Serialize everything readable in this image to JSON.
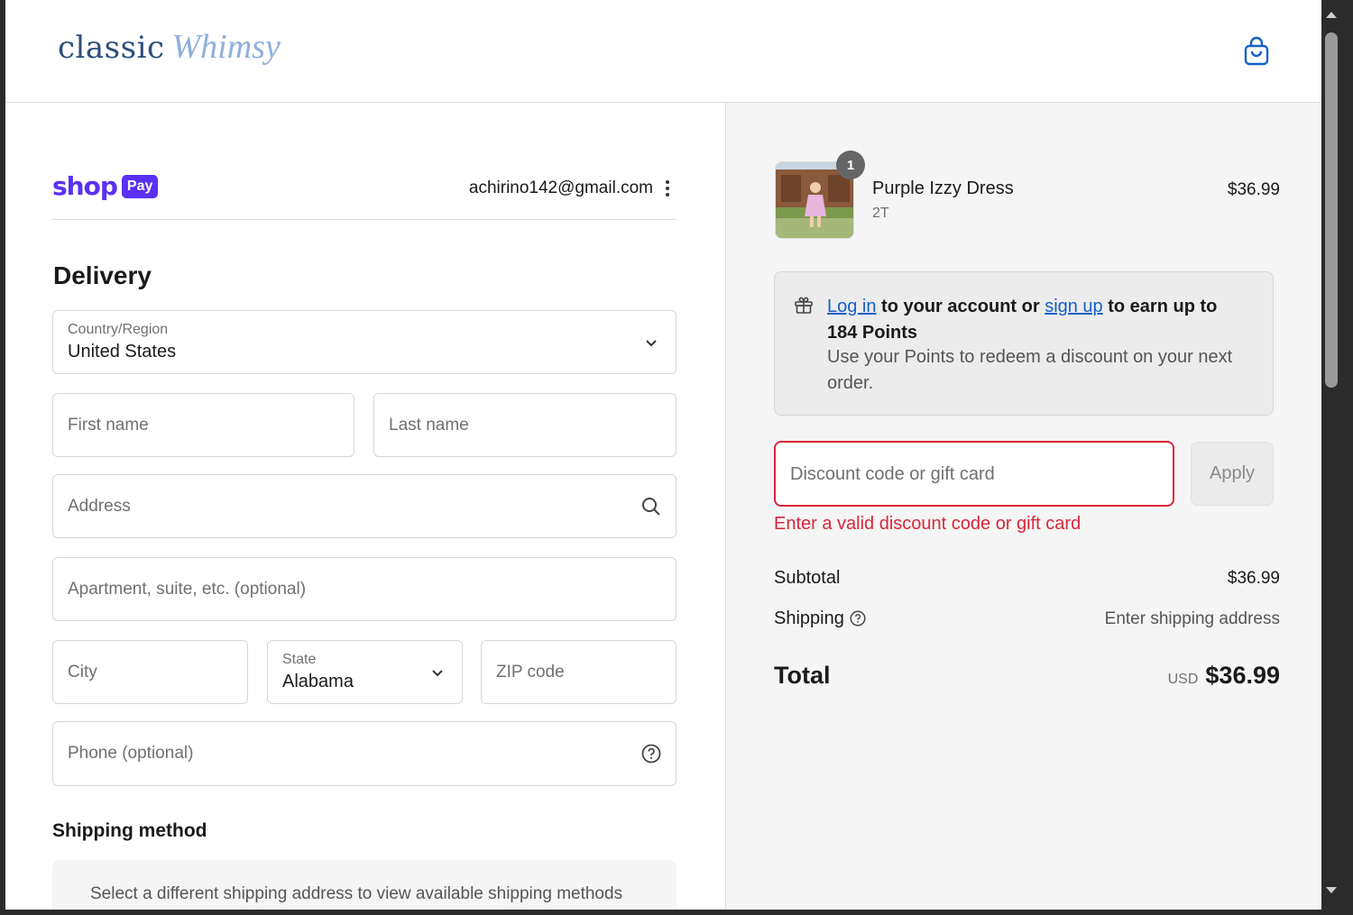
{
  "header": {
    "logo_classic": "classic",
    "logo_whimsy": "Whimsy",
    "cart_icon": "shopping-bag-icon"
  },
  "shop_pay": {
    "shop_text": "shop",
    "pay_badge": "Pay",
    "email": "achirino142@gmail.com",
    "menu_icon": "kebab-menu-icon"
  },
  "delivery": {
    "heading": "Delivery",
    "country": {
      "label": "Country/Region",
      "value": "United States"
    },
    "first_name": {
      "placeholder": "First name"
    },
    "last_name": {
      "placeholder": "Last name"
    },
    "address": {
      "placeholder": "Address"
    },
    "apartment": {
      "placeholder": "Apartment, suite, etc. (optional)"
    },
    "city": {
      "placeholder": "City"
    },
    "state": {
      "label": "State",
      "value": "Alabama"
    },
    "zip": {
      "placeholder": "ZIP code"
    },
    "phone": {
      "placeholder": "Phone (optional)"
    }
  },
  "shipping_method": {
    "heading": "Shipping method",
    "message": "Select a different shipping address to view available shipping methods"
  },
  "order": {
    "item": {
      "quantity": "1",
      "name": "Purple Izzy Dress",
      "variant": "2T",
      "price": "$36.99"
    },
    "points": {
      "login_link": "Log in",
      "text_middle": " to your account or ",
      "signup_link": "sign up",
      "text_end": " to earn up to 184 Points",
      "subtext": "Use your Points to redeem a discount on your next order."
    },
    "discount": {
      "placeholder": "Discount code or gift card",
      "apply_label": "Apply",
      "error": "Enter a valid discount code or gift card"
    },
    "subtotal_label": "Subtotal",
    "subtotal_value": "$36.99",
    "shipping_label": "Shipping",
    "shipping_value": "Enter shipping address",
    "total_label": "Total",
    "total_currency": "USD",
    "total_value": "$36.99"
  },
  "colors": {
    "shop_purple": "#5a31f4",
    "link_blue": "#1560c7",
    "error_red": "#d9263b",
    "logo_navy": "#2c4e7c",
    "logo_light_blue": "#8fb0dc"
  }
}
